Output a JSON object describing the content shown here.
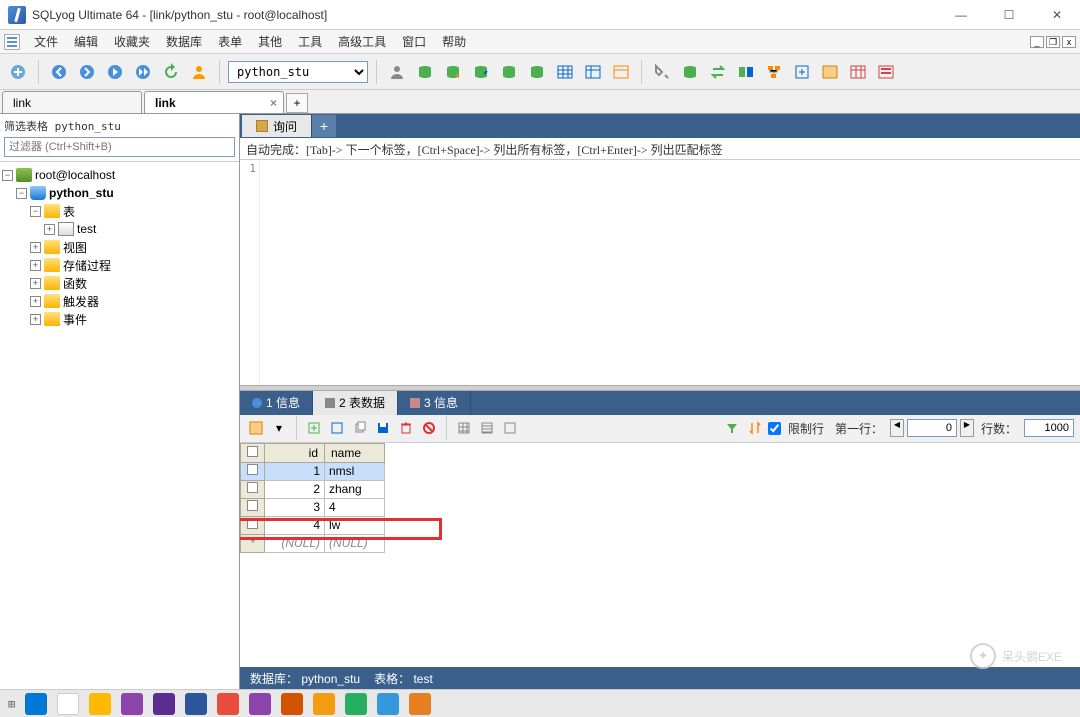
{
  "title": "SQLyog Ultimate 64 - [link/python_stu - root@localhost]",
  "menu": [
    "文件",
    "编辑",
    "收藏夹",
    "数据库",
    "表单",
    "其他",
    "工具",
    "高级工具",
    "窗口",
    "帮助"
  ],
  "db_selected": "python_stu",
  "conn_tabs": [
    {
      "label": "link",
      "active": false
    },
    {
      "label": "link",
      "active": true
    }
  ],
  "filter": {
    "label": "筛选表格 python_stu",
    "placeholder": "过滤器 (Ctrl+Shift+B)"
  },
  "tree": {
    "root": "root@localhost",
    "db": "python_stu",
    "folders": [
      "表",
      "视图",
      "存储过程",
      "函数",
      "触发器",
      "事件"
    ],
    "table": "test"
  },
  "query_tab": "询问",
  "hint": "自动完成：[Tab]-> 下一个标签，[Ctrl+Space]-> 列出所有标签，[Ctrl+Enter]-> 列出匹配标签",
  "gutter": "1",
  "result_tabs": [
    {
      "label": "1 信息",
      "active": false
    },
    {
      "label": "2 表数据",
      "active": true
    },
    {
      "label": "3 信息",
      "active": false
    }
  ],
  "result_toolbar": {
    "limit_label": "限制行",
    "first_row_label": "第一行：",
    "first_row": "0",
    "rows_label": "行数：",
    "rows": "1000"
  },
  "grid": {
    "columns": [
      "id",
      "name"
    ],
    "rows": [
      {
        "id": "1",
        "name": "nmsl",
        "sel": true
      },
      {
        "id": "2",
        "name": "zhang"
      },
      {
        "id": "3",
        "name": "4"
      },
      {
        "id": "4",
        "name": "lw",
        "hl": true
      }
    ],
    "null_row": {
      "id": "(NULL)",
      "name": "(NULL)"
    },
    "star": "*"
  },
  "status": {
    "db_label": "数据库：",
    "db": "python_stu",
    "tbl_label": "表格：",
    "tbl": "test"
  },
  "watermark": "呆头鹅EXE"
}
